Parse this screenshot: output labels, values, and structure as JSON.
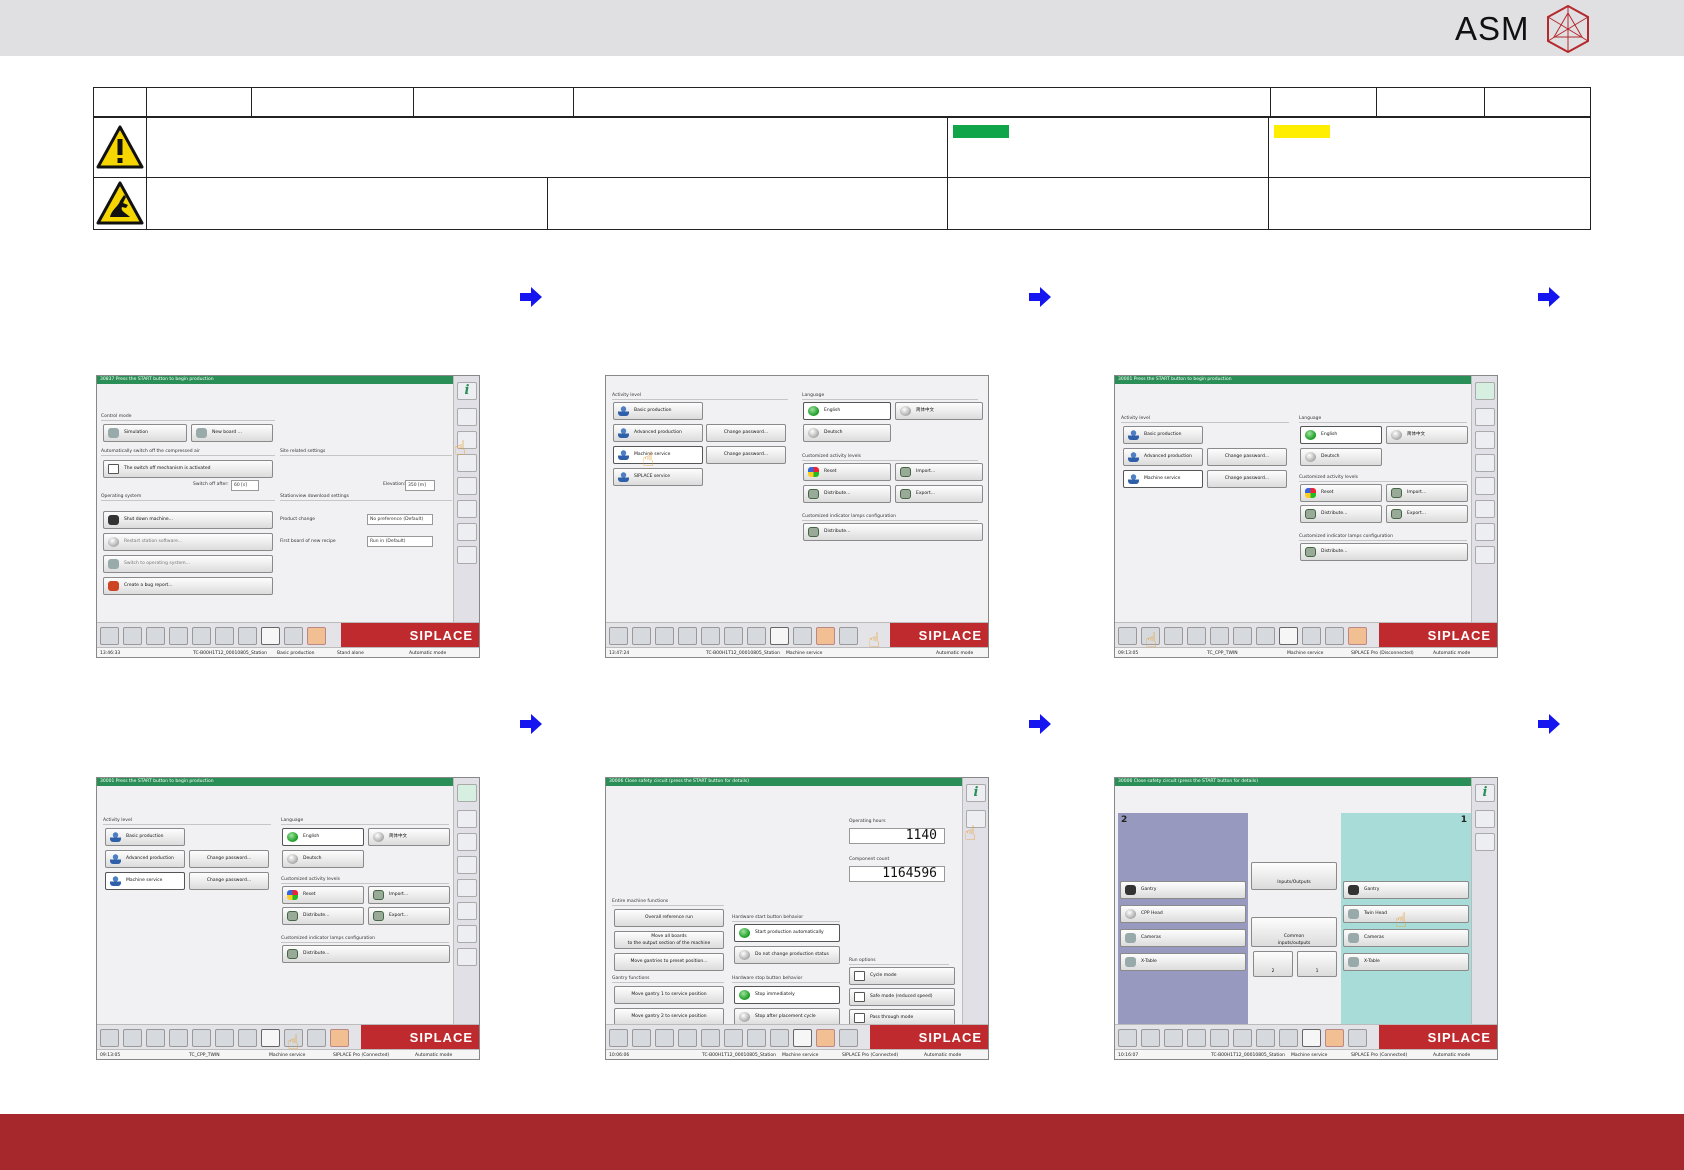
{
  "brand": {
    "logo_text": "ASM",
    "accent": "#a6282c",
    "swatch_green": "#11a54a",
    "swatch_yellow": "#ffee00"
  },
  "panels": {
    "p1": {
      "title": "30837 Press the START button to begin production",
      "section_control": "Control mode",
      "btn_simulation": "Simulation",
      "btn_newboard": "New board ...",
      "section_auto": "Automatically switch off the compressed air",
      "chk_switch": "The switch off mechanism is activated",
      "label_switch_after": "Switch off after:",
      "val_switch_after": "60 [s]",
      "section_site": "Site related settings",
      "label_elevation": "Elevation:",
      "val_elevation": "350 [m]",
      "section_os": "Operating system",
      "btn_shutdown": "Shut down machine...",
      "btn_restart": "Restart station software...",
      "btn_switchos": "Switch to operating system...",
      "btn_bug": "Create a bug report...",
      "section_download": "Stationview download settings",
      "label_product": "Product change",
      "val_product": "No preference (Default)",
      "label_firstboard": "First board of new recipe",
      "val_firstboard": "Run in (Default)",
      "brand": "SIPLACE",
      "st_time": "13:46:33",
      "st_station": "TC-B00H1T12_00010805_Station",
      "st_level": "Basic production",
      "st_conn": "Stand alone",
      "st_mode": "Automatic mode"
    },
    "p2": {
      "section_activity": "Activity level",
      "btn_basic": "Basic production",
      "btn_advanced": "Advanced production",
      "btn_machine": "Machine service",
      "btn_siplace": "SIPLACE service",
      "btn_change1": "Change password...",
      "btn_change2": "Change password...",
      "section_language": "Language",
      "btn_english": "English",
      "btn_chinese": "简体中文",
      "btn_deutsch": "Deutsch",
      "section_custom": "Customized activity levels",
      "btn_reset": "Reset",
      "btn_import": "Import...",
      "btn_distribute": "Distribute...",
      "btn_export": "Export...",
      "section_lamps": "Customized indicator lamps configuration",
      "btn_distribute2": "Distribute...",
      "brand": "SIPLACE",
      "st_time": "13:47:24",
      "st_station": "TC-B00H1T12_00010805_Station",
      "st_level": "Machine service",
      "st_mode": "Automatic mode"
    },
    "p3": {
      "title": "30001 Press the START button to begin production",
      "section_activity": "Activity level",
      "btn_basic": "Basic production",
      "btn_advanced": "Advanced production",
      "btn_machine": "Machine service",
      "btn_change1": "Change password...",
      "btn_change2": "Change password...",
      "section_language": "Language",
      "btn_english": "English",
      "btn_chinese": "简体中文",
      "btn_deutsch": "Deutsch",
      "section_custom": "Customized activity levels",
      "btn_reset": "Reset",
      "btn_import": "Import...",
      "btn_distribute": "Distribute...",
      "btn_export": "Export...",
      "section_lamps": "Customized indicator lamps configuration",
      "btn_distribute2": "Distribute...",
      "brand": "SIPLACE",
      "st_time": "09:13:05",
      "st_station": "TC_CPP_TWIN",
      "st_level": "Machine service",
      "st_conn": "SIPLACE Pro (Disconnected)",
      "st_mode": "Automatic mode"
    },
    "p4": {
      "title": "30001 Press the START button to begin production",
      "section_activity": "Activity level",
      "btn_basic": "Basic production",
      "btn_advanced": "Advanced production",
      "btn_machine": "Machine service",
      "btn_change1": "Change password...",
      "btn_change2": "Change password...",
      "section_language": "Language",
      "btn_english": "English",
      "btn_chinese": "简体中文",
      "btn_deutsch": "Deutsch",
      "section_custom": "Customized activity levels",
      "btn_reset": "Reset",
      "btn_import": "Import...",
      "btn_distribute": "Distribute...",
      "btn_export": "Export...",
      "section_lamps": "Customized indicator lamps configuration",
      "btn_distribute2": "Distribute...",
      "brand": "SIPLACE",
      "st_time": "09:13:05",
      "st_station": "TC_CPP_TWIN",
      "st_level": "Machine service",
      "st_conn": "SIPLACE Pro (Connected)",
      "st_mode": "Automatic mode"
    },
    "p5": {
      "title": "30006 Close safety circuit (press the START button for details)",
      "label_hours": "Operating hours",
      "val_hours": "1140",
      "label_count": "Component count",
      "val_count": "1164596",
      "section_entire": "Entire machine functions",
      "btn_overall": "Overall reference run",
      "btn_moveall_1": "Move all boards",
      "btn_moveall_2": "to the output section of the machine",
      "btn_preset": "Move gantries to preset position...",
      "section_gantry": "Gantry functions",
      "btn_gantry1": "Move gantry 1 to service position",
      "btn_gantry2": "Move gantry 2 to service position",
      "section_hwstart": "Hardware start button behavior",
      "btn_startauto": "Start production automatically",
      "btn_nochange": "Do not change production status",
      "section_hwstop": "Hardware stop button behavior",
      "btn_stopimm": "Stop immediately",
      "btn_stopafter": "Stop after placement cycle",
      "section_run": "Run options",
      "chk_cycle": "Cycle mode",
      "chk_safe": "Safe mode (reduced speed)",
      "chk_pass": "Pass through mode",
      "brand": "SIPLACE",
      "st_time": "10:06:06",
      "st_station": "TC-B00H1T12_00010805_Station",
      "st_level": "Machine service",
      "st_conn": "SIPLACE Pro (Connected)",
      "st_mode": "Automatic mode"
    },
    "p6": {
      "title": "30006 Close safety circuit (press the START button for details)",
      "zone_left": "2",
      "zone_right": "1",
      "btn_gantry_l": "Gantry",
      "btn_cpp_l": "CPP Head",
      "btn_cameras_l": "Cameras",
      "btn_xtable_l": "X-Table",
      "btn_io": "Inputs/Outputs",
      "btn_common_1": "Common",
      "btn_common_2": "inputs/outputs",
      "btn_m2": "2",
      "btn_m1": "1",
      "btn_gantry_r": "Gantry",
      "btn_twin_r": "Twin Head",
      "btn_cameras_r": "Cameras",
      "btn_xtable_r": "X-Table",
      "brand": "SIPLACE",
      "st_time": "10:16:07",
      "st_station": "TC-B00H1T12_00010805_Station",
      "st_level": "Machine service",
      "st_conn": "SIPLACE Pro (Connected)",
      "st_mode": "Automatic mode"
    }
  }
}
